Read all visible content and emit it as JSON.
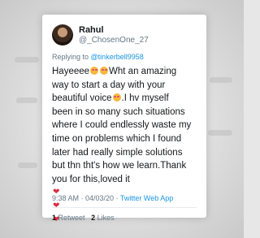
{
  "tweet": {
    "display_name": "Rahul",
    "handle": "@_ChosenOne_27",
    "replying_to_label": "Replying to",
    "replying_to_handle": "@tinkerbell9958",
    "text_lines": [
      "Hayeeee",
      "Wht an amazing",
      "way to start a day with your",
      "beautiful voice",
      ".I hv myself",
      "been in so many such situations",
      "where I could endlessly waste my",
      "time on problems which I found",
      "later had really simple solutions",
      "but thn tht's how we learn.Thank",
      "you for this,loved it"
    ],
    "icons": {
      "avatar": "profile-photo",
      "emoji_smile": "smiling-face-emoji",
      "emoji_heart": "red-heart-emoji"
    },
    "timestamp": "9:38 AM · 04/03/20 · ",
    "source": "Twitter Web App",
    "retweet_count": "1",
    "retweet_label": "Retweet",
    "like_count": "2",
    "like_label": "Likes"
  },
  "colors": {
    "text": "#14171a",
    "secondary": "#657786",
    "link": "#1b95e0",
    "emoji_face": "#f5b93b",
    "heart": "#dd2e44"
  }
}
